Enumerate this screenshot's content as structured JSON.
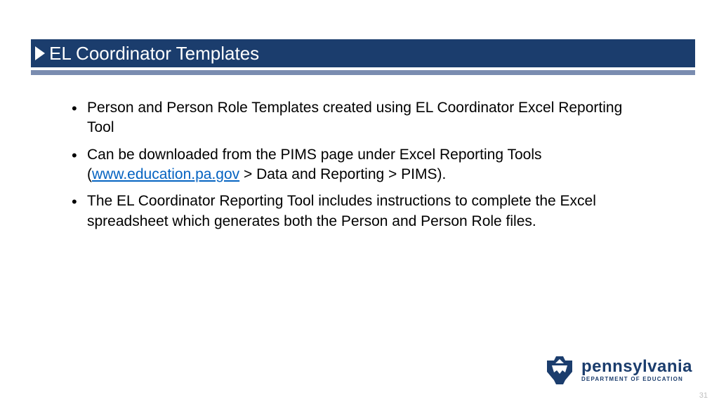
{
  "title": "EL Coordinator Templates",
  "bullets": [
    {
      "pre": "Person and Person Role Templates created using EL Coordinator Excel Reporting Tool",
      "link": "",
      "post": ""
    },
    {
      "pre": "Can be downloaded from the PIMS page under Excel Reporting Tools (",
      "link": "www.education.pa.gov",
      "post": " > Data and Reporting > PIMS)."
    },
    {
      "pre": "The EL Coordinator Reporting Tool includes instructions to complete the Excel spreadsheet which generates both the Person and Person Role files.",
      "link": "",
      "post": ""
    }
  ],
  "logo": {
    "state": "pennsylvania",
    "dept": "DEPARTMENT OF EDUCATION"
  },
  "page_number": "31"
}
